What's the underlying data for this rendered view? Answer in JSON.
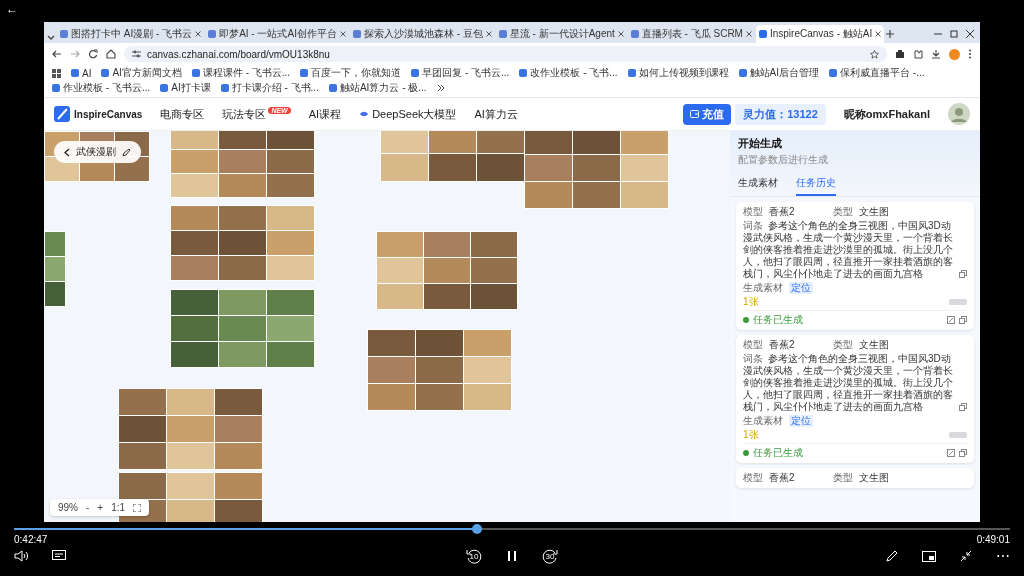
{
  "player": {
    "back": "←",
    "elapsed": "0:42:47",
    "total": "0:49:01",
    "level": 0.465,
    "rewind": "10",
    "forward": "30",
    "more": "⋯"
  },
  "browser": {
    "tabs": [
      {
        "title": "图搭打卡中 AI漫剧 - 飞书云",
        "selected": false
      },
      {
        "title": "即梦AI - 一站式AI创作平台",
        "selected": false
      },
      {
        "title": "探索入沙漠城池森林 - 豆包",
        "selected": false
      },
      {
        "title": "星流 - 新一代设计Agent",
        "selected": false
      },
      {
        "title": "直播列表 - 飞瓜 SCRM",
        "selected": false
      },
      {
        "title": "InspireCanvas - 触站AI",
        "selected": true
      }
    ],
    "url": "canvas.czhanai.com/board/vmOU13k8nu",
    "bookmarks": [
      "AI",
      "AI官方新闻文档",
      "课程课件 - 飞书云...",
      "百度一下，你就知道",
      "早团回复 - 飞书云...",
      "改作业模板 - 飞书...",
      "如何上传视频到课程",
      "触站AI后台管理",
      "保利威直播平台 -...",
      "作业模板 - 飞书云...",
      "AI打卡课",
      "打卡课介绍 - 飞书...",
      "触站AI算力云 - 极..."
    ]
  },
  "app": {
    "logo": "InspireCanvas",
    "nav": [
      {
        "label": "电商专区"
      },
      {
        "label": "玩法专区",
        "badge": "NEW"
      },
      {
        "label": "AI课程"
      },
      {
        "label": "DeepSeek大模型"
      },
      {
        "label": "AI算力云"
      }
    ],
    "recharge": "充值",
    "balance": "灵力值：13122",
    "nickname": "昵称omxFhakanl"
  },
  "board": {
    "title": "武侠漫剧",
    "zoom": "99%",
    "zoom_out": "-",
    "zoom_in": "+",
    "fit": "1:1"
  },
  "panel": {
    "title": "开始生成",
    "subtitle": "配置参数后进行生成",
    "tabs": [
      {
        "label": "生成素材",
        "selected": false
      },
      {
        "label": "任务历史",
        "selected": true
      }
    ],
    "tasks": [
      {
        "model_label": "模型",
        "model": "香蕉2",
        "type_label": "类型",
        "type": "文生图",
        "prompt_label": "词条",
        "prompt": "参考这个角色的全身三视图，中国风3D动漫武侠风格，生成一个黄沙漫天里，一个背着长剑的侠客推着推走进沙漠里的孤城。街上没几个人，他扫了眼四周，径直推开一家挂着酒旗的客栈门，风尘仆仆地走了进去的画面九宫格",
        "assets_label": "生成素材",
        "locate": "定位",
        "count": "1张",
        "status": "任务已生成"
      },
      {
        "model_label": "模型",
        "model": "香蕉2",
        "type_label": "类型",
        "type": "文生图",
        "prompt_label": "词条",
        "prompt": "参考这个角色的全身三视图，中国风3D动漫武侠风格，生成一个黄沙漫天里，一个背着长剑的侠客推着推走进沙漠里的孤城。街上没几个人，他扫了眼四周，径直推开一家挂着酒旗的客栈门，风尘仆仆地走了进去的画面九宫格",
        "assets_label": "生成素材",
        "locate": "定位",
        "count": "1张",
        "status": "任务已生成"
      },
      {
        "model_label": "模型",
        "model": "香蕉2",
        "type_label": "类型",
        "type": "文生图"
      }
    ]
  }
}
